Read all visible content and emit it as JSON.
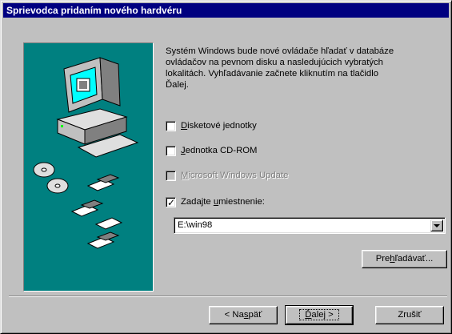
{
  "window": {
    "title": "Sprievodca pridaním nového hardvéru"
  },
  "intro": {
    "lines": [
      "Systém Windows bude nové ovládače hľadať v databáze",
      "ovládačov na pevnom disku a nasledujúcich vybratých",
      "lokalitách. Vyhľadávanie začnete kliknutím na tlačidlo",
      "Ďalej."
    ]
  },
  "options": [
    {
      "label_u": "D",
      "label_rest": "isketové jednotky",
      "checked": false,
      "enabled": true
    },
    {
      "label_u": "J",
      "label_rest": "ednotka CD-ROM",
      "checked": false,
      "enabled": true
    },
    {
      "label_u": "M",
      "label_rest": "icrosoft Windows Update",
      "checked": false,
      "enabled": false
    },
    {
      "label_pre": "Zadajte ",
      "label_u": "u",
      "label_rest": "miestnenie:",
      "checked": true,
      "enabled": true
    }
  ],
  "location": {
    "value": "E:\\win98"
  },
  "buttons": {
    "browse": {
      "pre": "Pre",
      "u": "h",
      "rest": "ľadávať..."
    },
    "back": {
      "pre": "< Na",
      "u": "s",
      "rest": "päť"
    },
    "next": {
      "pre": "",
      "u": "Ď",
      "rest": "alej >"
    },
    "cancel": "Zrušiť"
  },
  "colors": {
    "titlebar": "#000080",
    "dialog": "#c0c0c0",
    "illustration_bg": "#008080"
  }
}
